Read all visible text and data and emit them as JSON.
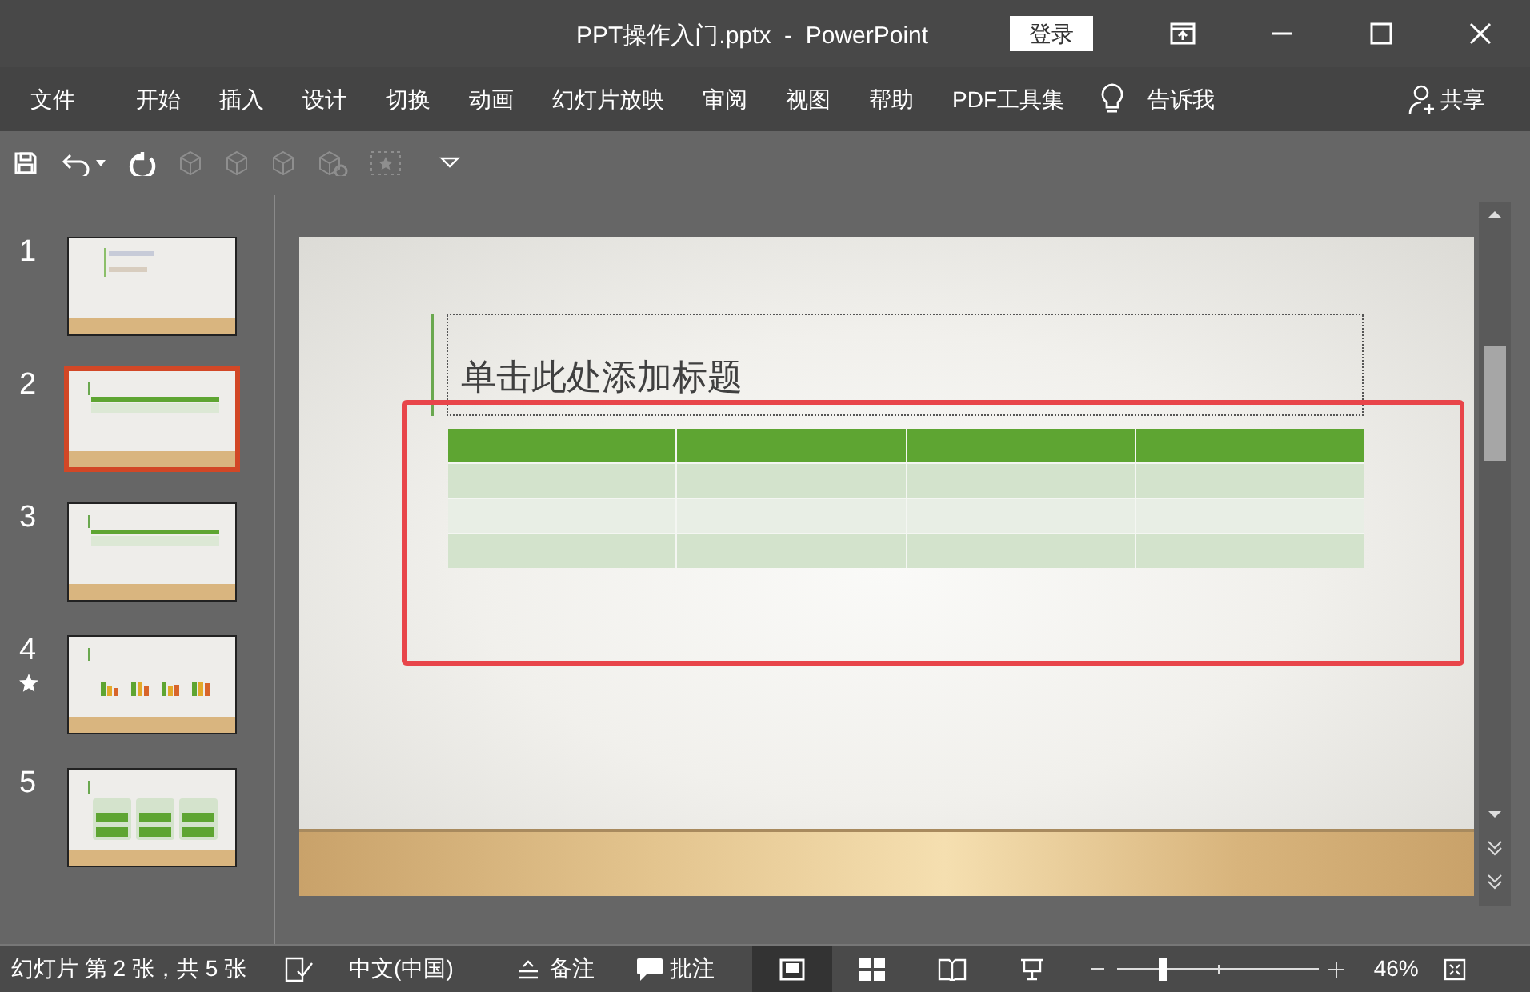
{
  "window": {
    "title": "PPT操作入门.pptx  -  PowerPoint",
    "login_button": "登录"
  },
  "ribbon_tabs": [
    {
      "label": "文件"
    },
    {
      "label": "开始"
    },
    {
      "label": "插入"
    },
    {
      "label": "设计"
    },
    {
      "label": "切换"
    },
    {
      "label": "动画"
    },
    {
      "label": "幻灯片放映"
    },
    {
      "label": "审阅"
    },
    {
      "label": "视图"
    },
    {
      "label": "帮助"
    },
    {
      "label": "PDF工具集"
    }
  ],
  "tell_me": "告诉我",
  "share": "共享",
  "slides": [
    {
      "number": "1",
      "kind": "title",
      "selected": false,
      "animated": false
    },
    {
      "number": "2",
      "kind": "table",
      "selected": true,
      "animated": false
    },
    {
      "number": "3",
      "kind": "table",
      "selected": false,
      "animated": false
    },
    {
      "number": "4",
      "kind": "chart",
      "selected": false,
      "animated": true
    },
    {
      "number": "5",
      "kind": "boxes",
      "selected": false,
      "animated": false
    }
  ],
  "current_slide": {
    "title_placeholder": "单击此处添加标题",
    "highlighted": true
  },
  "status_bar": {
    "slide_info": "幻灯片 第 2 张，共 5 张",
    "language": "中文(中国)",
    "notes": "备注",
    "comments": "批注",
    "views": [
      {
        "kind": "normal",
        "selected": true
      },
      {
        "kind": "sorter",
        "selected": false
      },
      {
        "kind": "reading",
        "selected": false
      },
      {
        "kind": "show",
        "selected": false
      }
    ],
    "zoom": {
      "level": 0.22,
      "reading": "46%"
    }
  }
}
